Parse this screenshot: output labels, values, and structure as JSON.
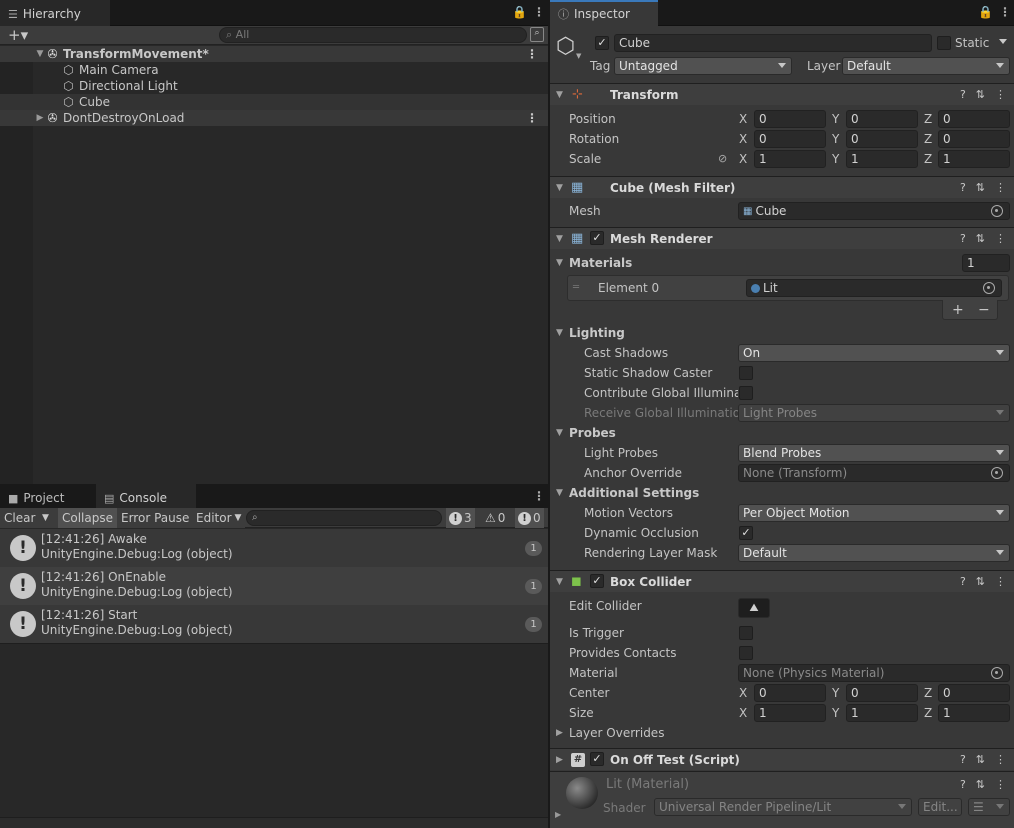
{
  "hierarchy": {
    "tab_label": "Hierarchy",
    "search_placeholder": "All",
    "rows": [
      {
        "label": "TransformMovement*",
        "type": "scene",
        "level": 0,
        "expanded": true
      },
      {
        "label": "Main Camera",
        "type": "object",
        "level": 1
      },
      {
        "label": "Directional Light",
        "type": "object",
        "level": 1
      },
      {
        "label": "Cube",
        "type": "object",
        "level": 1,
        "selected": true
      },
      {
        "label": "DontDestroyOnLoad",
        "type": "scene",
        "level": 0,
        "expanded": false
      }
    ]
  },
  "console": {
    "tabs": [
      "Project",
      "Console"
    ],
    "toolbar": {
      "clear": "Clear",
      "collapse": "Collapse",
      "error_pause": "Error Pause",
      "editor": "Editor",
      "info_count": "3",
      "warn_count": "0",
      "error_count": "0"
    },
    "logs": [
      {
        "line1": "[12:41:26] Awake",
        "line2": "UnityEngine.Debug:Log (object)",
        "count": "1"
      },
      {
        "line1": "[12:41:26] OnEnable",
        "line2": "UnityEngine.Debug:Log (object)",
        "count": "1"
      },
      {
        "line1": "[12:41:26] Start",
        "line2": "UnityEngine.Debug:Log (object)",
        "count": "1"
      }
    ]
  },
  "inspector": {
    "tab_label": "Inspector",
    "object_name": "Cube",
    "static_label": "Static",
    "tag_label": "Tag",
    "tag_value": "Untagged",
    "layer_label": "Layer",
    "layer_value": "Default",
    "transform": {
      "title": "Transform",
      "position_label": "Position",
      "rotation_label": "Rotation",
      "scale_label": "Scale",
      "position": [
        "0",
        "0",
        "0"
      ],
      "rotation": [
        "0",
        "0",
        "0"
      ],
      "scale": [
        "1",
        "1",
        "1"
      ],
      "axes": [
        "X",
        "Y",
        "Z"
      ]
    },
    "mesh_filter": {
      "title": "Cube (Mesh Filter)",
      "mesh_label": "Mesh",
      "mesh_value": "Cube"
    },
    "mesh_renderer": {
      "title": "Mesh Renderer",
      "materials_label": "Materials",
      "materials_count": "1",
      "element_label": "Element 0",
      "element_value": "Lit",
      "plus": "+",
      "minus": "−",
      "lighting_label": "Lighting",
      "cast_shadows_label": "Cast Shadows",
      "cast_shadows_value": "On",
      "static_shadow_label": "Static Shadow Caster",
      "contribute_gi_label": "Contribute Global Illuminati",
      "receive_gi_label": "Receive Global Illumination",
      "receive_gi_value": "Light Probes",
      "probes_label": "Probes",
      "light_probes_label": "Light Probes",
      "light_probes_value": "Blend Probes",
      "anchor_label": "Anchor Override",
      "anchor_value": "None (Transform)",
      "additional_label": "Additional Settings",
      "motion_label": "Motion Vectors",
      "motion_value": "Per Object Motion",
      "dynamic_occ_label": "Dynamic Occlusion",
      "rendering_mask_label": "Rendering Layer Mask",
      "rendering_mask_value": "Default"
    },
    "box_collider": {
      "title": "Box Collider",
      "edit_label": "Edit Collider",
      "trigger_label": "Is Trigger",
      "contacts_label": "Provides Contacts",
      "material_label": "Material",
      "material_value": "None (Physics Material)",
      "center_label": "Center",
      "center": [
        "0",
        "0",
        "0"
      ],
      "size_label": "Size",
      "size": [
        "1",
        "1",
        "1"
      ],
      "layer_overrides_label": "Layer Overrides"
    },
    "script": {
      "title": "On Off Test (Script)"
    },
    "material": {
      "title": "Lit (Material)",
      "shader_label": "Shader",
      "shader_value": "Universal Render Pipeline/Lit",
      "edit_label": "Edit..."
    }
  },
  "colors": {
    "accent": "#3a79bb",
    "selection": "#2c5d87"
  }
}
